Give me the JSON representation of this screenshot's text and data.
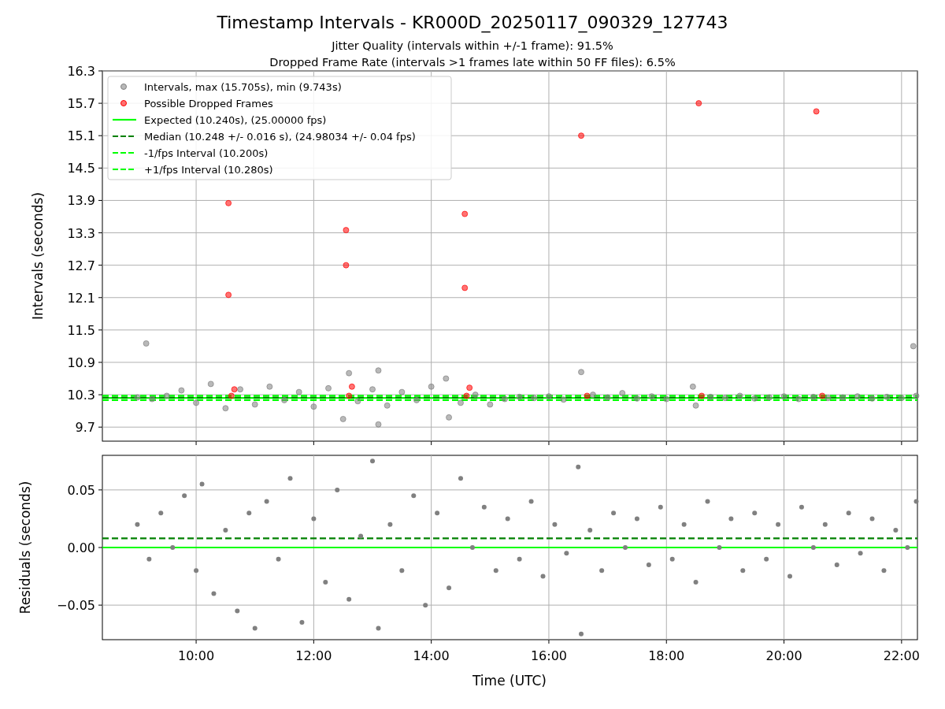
{
  "figure": {
    "title": "Timestamp Intervals - KR000D_20250117_090329_127743",
    "subtitle_lines": [
      "Jitter Quality (intervals within +/-1 frame): 91.5%",
      "Dropped Frame Rate (intervals >1 frames late within 50 FF files): 6.5%"
    ]
  },
  "top_panel": {
    "chart_data": {
      "type": "scatter",
      "ylabel": "Intervals (seconds)",
      "xlim": [
        8.405,
        22.27
      ],
      "ylim": [
        9.44,
        16.3
      ],
      "yticks": [
        {
          "value": 9.7,
          "label": "9.7"
        },
        {
          "value": 10.3,
          "label": "10.3"
        },
        {
          "value": 10.9,
          "label": "10.9"
        },
        {
          "value": 11.5,
          "label": "11.5"
        },
        {
          "value": 12.1,
          "label": "12.1"
        },
        {
          "value": 12.7,
          "label": "12.7"
        },
        {
          "value": 13.3,
          "label": "13.3"
        },
        {
          "value": 13.9,
          "label": "13.9"
        },
        {
          "value": 14.5,
          "label": "14.5"
        },
        {
          "value": 15.1,
          "label": "15.1"
        },
        {
          "value": 15.7,
          "label": "15.7"
        },
        {
          "value": 16.3,
          "label": "16.3"
        }
      ],
      "series": [
        {
          "name": "Intervals, max (15.705s), min (9.743s)",
          "color": "#808080",
          "x": [
            9.0,
            9.15,
            9.25,
            9.5,
            9.75,
            10.0,
            10.25,
            10.5,
            10.75,
            11.0,
            11.25,
            11.5,
            11.75,
            12.0,
            12.25,
            12.5,
            12.6,
            12.75,
            13.0,
            13.1,
            13.1,
            13.25,
            13.5,
            13.75,
            14.0,
            14.25,
            14.3,
            14.5,
            14.75,
            15.0,
            15.25,
            15.5,
            15.75,
            16.0,
            16.25,
            16.55,
            16.75,
            17.0,
            17.25,
            17.5,
            17.75,
            18.0,
            18.45,
            18.5,
            18.75,
            19.0,
            19.25,
            19.5,
            19.75,
            20.0,
            20.25,
            20.5,
            20.75,
            21.0,
            21.25,
            21.5,
            21.75,
            22.0,
            22.2,
            22.25
          ],
          "values": [
            10.25,
            11.25,
            10.22,
            10.28,
            10.38,
            10.15,
            10.5,
            10.05,
            10.4,
            10.12,
            10.45,
            10.2,
            10.35,
            10.08,
            10.42,
            9.85,
            10.7,
            10.18,
            10.4,
            9.75,
            10.75,
            10.1,
            10.35,
            10.2,
            10.45,
            10.6,
            9.88,
            10.15,
            10.3,
            10.12,
            10.22,
            10.26,
            10.24,
            10.27,
            10.21,
            10.72,
            10.3,
            10.25,
            10.33,
            10.23,
            10.27,
            10.22,
            10.45,
            10.1,
            10.26,
            10.24,
            10.28,
            10.23,
            10.25,
            10.27,
            10.22,
            10.26,
            10.24,
            10.25,
            10.27,
            10.23,
            10.26,
            10.24,
            11.2,
            10.28
          ]
        },
        {
          "name": "Possible Dropped Frames",
          "color": "#ff0000",
          "x": [
            10.55,
            10.55,
            10.6,
            10.65,
            12.55,
            12.55,
            12.6,
            12.65,
            14.57,
            14.57,
            14.6,
            14.65,
            16.55,
            16.65,
            18.55,
            18.6,
            20.55,
            20.65
          ],
          "values": [
            13.85,
            12.15,
            10.28,
            10.4,
            13.35,
            12.7,
            10.28,
            10.45,
            13.65,
            12.28,
            10.28,
            10.43,
            15.1,
            10.28,
            15.7,
            10.28,
            15.55,
            10.28
          ]
        }
      ],
      "ref_lines": [
        {
          "axis": "y",
          "value": 10.24,
          "label": "Expected (10.240s), (25.00000 fps)",
          "color": "#00ff00"
        },
        {
          "axis": "y",
          "value": 10.248,
          "label": "Median (10.248 +/- 0.016 s), (24.98034 +/- 0.04 fps)",
          "color": "#008000"
        },
        {
          "axis": "y",
          "value": 10.2,
          "label": "-1/fps Interval (10.200s)",
          "color": "#00ff00"
        },
        {
          "axis": "y",
          "value": 10.28,
          "label": "+1/fps Interval (10.280s)",
          "color": "#00ff00"
        }
      ],
      "grid": true,
      "legend": true
    }
  },
  "bottom_panel": {
    "chart_data": {
      "type": "scatter",
      "xlabel": "Time (UTC)",
      "ylabel": "Residuals (seconds)",
      "xlim": [
        8.405,
        22.27
      ],
      "ylim": [
        -0.08,
        0.08
      ],
      "xticks": [
        {
          "value": 10,
          "label": "10:00"
        },
        {
          "value": 12,
          "label": "12:00"
        },
        {
          "value": 14,
          "label": "14:00"
        },
        {
          "value": 16,
          "label": "16:00"
        },
        {
          "value": 18,
          "label": "18:00"
        },
        {
          "value": 20,
          "label": "20:00"
        },
        {
          "value": 22,
          "label": "22:00"
        }
      ],
      "yticks": [
        {
          "value": -0.05,
          "label": "−0.05"
        },
        {
          "value": 0,
          "label": "0.00"
        },
        {
          "value": 0.05,
          "label": "0.05"
        }
      ],
      "series": [
        {
          "color": "#808080",
          "x": [
            9.0,
            9.2,
            9.4,
            9.6,
            9.8,
            10.0,
            10.1,
            10.3,
            10.5,
            10.7,
            10.9,
            11.0,
            11.2,
            11.4,
            11.6,
            11.8,
            12.0,
            12.2,
            12.4,
            12.6,
            12.8,
            13.0,
            13.1,
            13.3,
            13.5,
            13.7,
            13.9,
            14.1,
            14.3,
            14.5,
            14.7,
            14.9,
            15.1,
            15.3,
            15.5,
            15.7,
            15.9,
            16.1,
            16.3,
            16.5,
            16.55,
            16.7,
            16.9,
            17.1,
            17.3,
            17.5,
            17.7,
            17.9,
            18.1,
            18.3,
            18.5,
            18.7,
            18.9,
            19.1,
            19.3,
            19.5,
            19.7,
            19.9,
            20.1,
            20.3,
            20.5,
            20.7,
            20.9,
            21.1,
            21.3,
            21.5,
            21.7,
            21.9,
            22.1,
            22.25
          ],
          "values": [
            0.02,
            -0.01,
            0.03,
            0.0,
            0.045,
            -0.02,
            0.055,
            -0.04,
            0.015,
            -0.055,
            0.03,
            -0.07,
            0.04,
            -0.01,
            0.06,
            -0.065,
            0.025,
            -0.03,
            0.05,
            -0.045,
            0.01,
            0.075,
            -0.07,
            0.02,
            -0.02,
            0.045,
            -0.05,
            0.03,
            -0.035,
            0.06,
            0.0,
            0.035,
            -0.02,
            0.025,
            -0.01,
            0.04,
            -0.025,
            0.02,
            -0.005,
            0.07,
            -0.075,
            0.015,
            -0.02,
            0.03,
            0.0,
            0.025,
            -0.015,
            0.035,
            -0.01,
            0.02,
            -0.03,
            0.04,
            0.0,
            0.025,
            -0.02,
            0.03,
            -0.01,
            0.02,
            -0.025,
            0.035,
            0.0,
            0.02,
            -0.015,
            0.03,
            -0.005,
            0.025,
            -0.02,
            0.015,
            0.0,
            0.04
          ]
        }
      ],
      "ref_lines": [
        {
          "axis": "y",
          "value": 0.008,
          "color": "#008000"
        },
        {
          "axis": "y",
          "value": 0.0,
          "color": "#00ff00"
        }
      ],
      "grid": true
    }
  }
}
